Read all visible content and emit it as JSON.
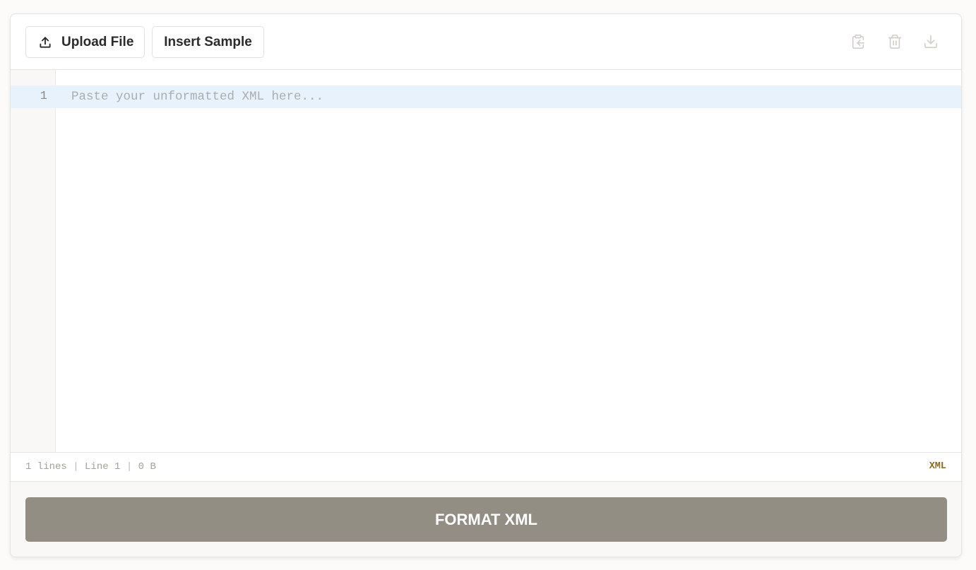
{
  "toolbar": {
    "upload_label": "Upload File",
    "sample_label": "Insert Sample",
    "icons": [
      "paste-icon",
      "trash-icon",
      "download-icon"
    ],
    "icon_color": "#d2cfca"
  },
  "editor": {
    "line_numbers": [
      "1"
    ],
    "placeholder": "Paste your unformatted XML here...",
    "active_line_color": "#e8f2fc"
  },
  "status": {
    "lines": "1 lines",
    "separator": "|",
    "cursor": "Line 1",
    "size": "0 B",
    "language": "XML"
  },
  "footer": {
    "format_label": "FORMAT XML",
    "button_color": "#938e84"
  }
}
